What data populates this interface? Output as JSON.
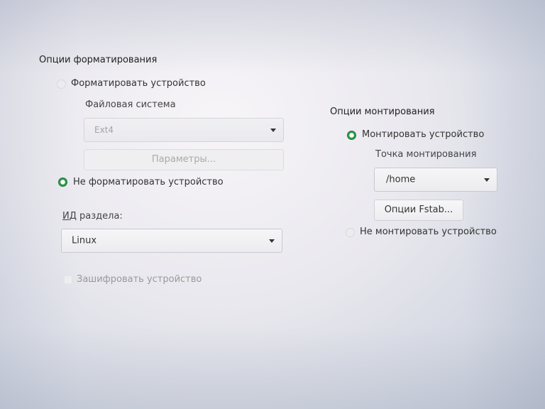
{
  "format": {
    "section_title": "Опции форматирования",
    "format_device_label": "Форматировать устройство",
    "filesystem_label": "Файловая система",
    "filesystem_value": "Ext4",
    "parameters_button": "Параметры...",
    "no_format_label": "Не форматировать устройство",
    "partition_id_label_first": "И",
    "partition_id_label_rest": "Д раздела:",
    "partition_id_value": "Linux",
    "encrypt_label": "Зашифровать устройство"
  },
  "mount": {
    "section_title": "Опции монтирования",
    "mount_device_label": "Монтировать устройство",
    "mount_point_label": "Точка монтирования",
    "mount_point_value": "/home",
    "fstab_button": "Опции Fstab...",
    "no_mount_label": "Не монтировать устройство"
  },
  "colors": {
    "radio_selected": "#2f9a4a",
    "text": "#2f2f2f",
    "disabled_text": "#a3a3a8"
  }
}
